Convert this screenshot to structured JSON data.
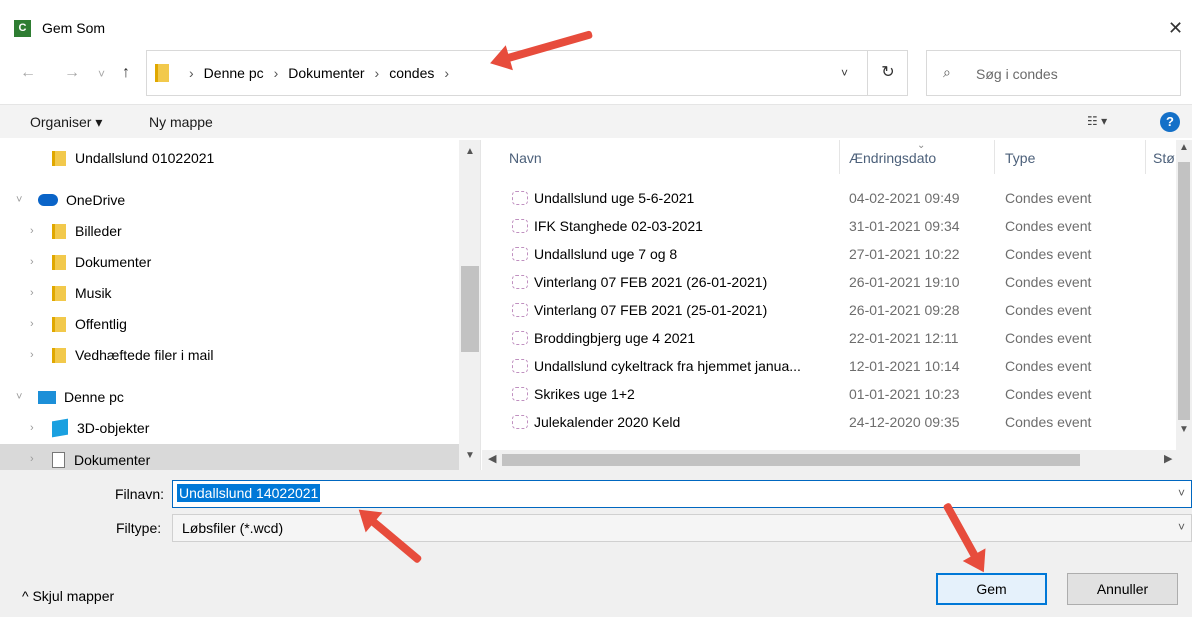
{
  "window": {
    "title": "Gem Som",
    "app_icon": "C",
    "close": "✕"
  },
  "nav": {
    "back": "←",
    "forward": "→",
    "history": "˅",
    "up": "↑"
  },
  "address": {
    "crumbs": [
      "Denne pc",
      "Dokumenter",
      "condes"
    ],
    "separator": "›",
    "dropdown": "˅",
    "refresh": "↻"
  },
  "search": {
    "placeholder": "Søg i condes",
    "icon": "⌕"
  },
  "toolbar": {
    "organize": "Organiser ▾",
    "new_folder": "Ny mappe",
    "view": "☷ ▾",
    "help": "?"
  },
  "tree": {
    "items": [
      {
        "label": "Undallslund 01022021",
        "chev": ""
      },
      {
        "label": "OneDrive",
        "chev": "˅"
      },
      {
        "label": "Billeder",
        "chev": "›"
      },
      {
        "label": "Dokumenter",
        "chev": "›"
      },
      {
        "label": "Musik",
        "chev": "›"
      },
      {
        "label": "Offentlig",
        "chev": "›"
      },
      {
        "label": "Vedhæftede filer i mail",
        "chev": "›"
      },
      {
        "label": "Denne pc",
        "chev": "˅"
      },
      {
        "label": "3D-objekter",
        "chev": "›"
      },
      {
        "label": "Dokumenter",
        "chev": "›"
      }
    ]
  },
  "columns": {
    "name": "Navn",
    "date": "Ændringsdato",
    "type": "Type",
    "size": "Stø"
  },
  "files": [
    {
      "name": "Undallslund uge 5-6-2021",
      "date": "04-02-2021 09:49",
      "type": "Condes event"
    },
    {
      "name": "IFK Stanghede 02-03-2021",
      "date": "31-01-2021 09:34",
      "type": "Condes event"
    },
    {
      "name": "Undallslund uge 7 og 8",
      "date": "27-01-2021 10:22",
      "type": "Condes event"
    },
    {
      "name": "Vinterlang 07 FEB 2021 (26-01-2021)",
      "date": "26-01-2021 19:10",
      "type": "Condes event"
    },
    {
      "name": "Vinterlang 07 FEB 2021 (25-01-2021)",
      "date": "26-01-2021 09:28",
      "type": "Condes event"
    },
    {
      "name": "Broddingbjerg uge 4 2021",
      "date": "22-01-2021 12:11",
      "type": "Condes event"
    },
    {
      "name": "Undallslund cykeltrack fra hjemmet janua...",
      "date": "12-01-2021 10:14",
      "type": "Condes event"
    },
    {
      "name": "Skrikes uge 1+2",
      "date": "01-01-2021 10:23",
      "type": "Condes event"
    },
    {
      "name": "Julekalender 2020 Keld",
      "date": "24-12-2020 09:35",
      "type": "Condes event"
    }
  ],
  "form": {
    "filename_label": "Filnavn:",
    "filename_value": "Undallslund 14022021",
    "filetype_label": "Filtype:",
    "filetype_value": "Løbsfiler (*.wcd)",
    "dropdown": "˅"
  },
  "footer": {
    "hide_folders": "^  Skjul mapper",
    "save": "Gem",
    "cancel": "Annuller"
  },
  "colors": {
    "accent": "#0078d7",
    "arrow": "#e74c3c"
  }
}
